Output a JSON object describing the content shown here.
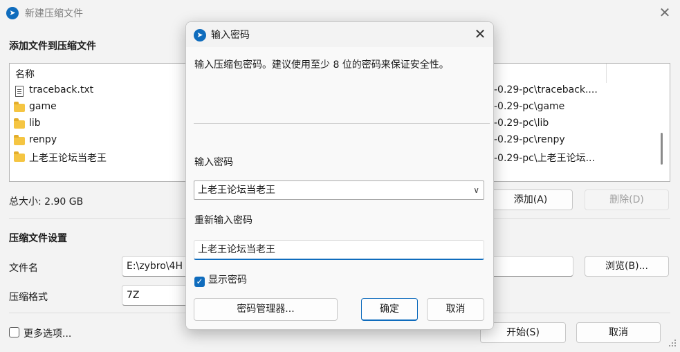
{
  "main": {
    "title": "新建压缩文件",
    "add_section_title": "添加文件到压缩文件",
    "file_list": {
      "header_name": "名称",
      "rows": [
        {
          "name": "traceback.txt",
          "type": "file",
          "path": "-0.29-pc\\traceback...."
        },
        {
          "name": "game",
          "type": "folder",
          "path": "-0.29-pc\\game"
        },
        {
          "name": "lib",
          "type": "folder",
          "path": "-0.29-pc\\lib"
        },
        {
          "name": "renpy",
          "type": "folder",
          "path": "-0.29-pc\\renpy"
        },
        {
          "name": "上老王论坛当老王",
          "type": "folder",
          "path": "-0.29-pc\\上老王论坛..."
        }
      ]
    },
    "total_size": "总大小: 2.90 GB",
    "add_button": "添加(A)",
    "delete_button": "删除(D)",
    "settings_title": "压缩文件设置",
    "filename_label": "文件名",
    "filename_value": "E:\\zybro\\4H",
    "browse_button": "浏览(B)...",
    "format_label": "压缩格式",
    "format_value": "7Z",
    "more_options": "更多选项...",
    "start_button": "开始(S)",
    "cancel_button": "取消"
  },
  "dialog": {
    "title": "输入密码",
    "description": "输入压缩包密码。建议使用至少 8 位的密码来保证安全性。",
    "password_label": "输入密码",
    "password_value": "上老王论坛当老王",
    "reenter_label": "重新输入密码",
    "reenter_value": "上老王论坛当老王",
    "show_password_label": "显示密码",
    "show_password_checked": true,
    "manager_button": "密码管理器...",
    "ok_button": "确定",
    "cancel_button": "取消"
  },
  "icons": {
    "app": "app-logo-icon",
    "close": "close-icon",
    "folder": "folder-icon",
    "file": "file-icon",
    "dropdown": "chevron-down-icon",
    "check": "checkmark-icon"
  },
  "colors": {
    "accent": "#0f6cbd",
    "folder": "#f5c542"
  }
}
